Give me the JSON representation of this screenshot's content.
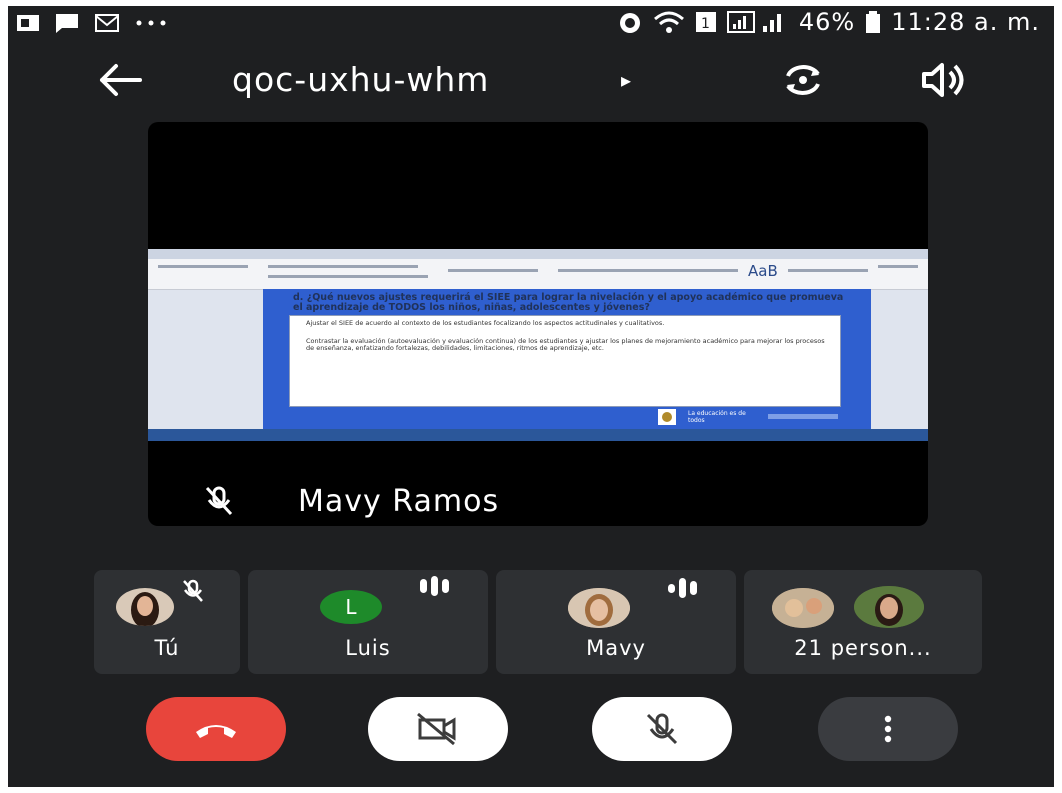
{
  "status_bar": {
    "left_icons": [
      "app-icon",
      "message-icon",
      "gmail-icon",
      "more-dots-icon"
    ],
    "battery_percent": "46%",
    "time": "11:28 a. m."
  },
  "topbar": {
    "meeting_code": "qoc-uxhu-whm",
    "caret": "▸"
  },
  "stage": {
    "presenter_name": "Mavy Ramos",
    "shared_doc": {
      "heading": "d. ¿Qué nuevos ajustes requerirá el SIEE para lograr la nivelación y el apoyo académico que promueva el aprendizaje de TODOS los niños, niñas, adolescentes y jóvenes?",
      "line1": "Ajustar el SIEE de acuerdo al contexto de los estudiantes focalizando los aspectos actitudinales y cualitativos.",
      "line2": "Contrastar la evaluación (autoevaluación y evaluación continua) de los estudiantes y ajustar los planes de mejoramiento académico para mejorar los procesos de enseñanza, enfatizando fortalezas, debilidades, limitaciones, ritmos de aprendizaje, etc.",
      "footer_text": "La educación es de todos",
      "ribbon_style": "AaB"
    }
  },
  "participants": [
    {
      "label": "Tú",
      "muted": true
    },
    {
      "label": "Luis",
      "initial": "L",
      "speaking": true
    },
    {
      "label": "Mavy",
      "speaking": true
    },
    {
      "label": "21 person..."
    }
  ],
  "colors": {
    "background": "#1e1f21",
    "tile": "#2e3033",
    "end_call": "#e8453c",
    "avatar_green": "#1e8a2a",
    "doc_blue": "#2f5fcf"
  }
}
